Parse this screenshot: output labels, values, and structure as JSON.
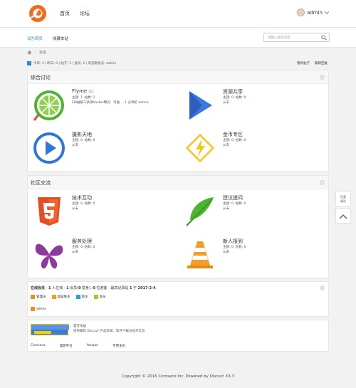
{
  "nav": {
    "home": "首页",
    "forum": "论坛",
    "username": "admin"
  },
  "subnav": {
    "set_home": "设为首页",
    "bookmark": "收藏本站",
    "search_placeholder": "请输入搜索内容"
  },
  "breadcrumb": {
    "current": "论坛"
  },
  "stats": {
    "text": "今日: 1 | 昨日: 0 | 帖子: 1 | 会员: 1 | 欢迎新会员: admin",
    "my_posts": "我的帖子",
    "latest_replies": "最新回复"
  },
  "sections": [
    {
      "title": "综合讨论",
      "forums": [
        {
          "name": "Flyme",
          "today": "(1)",
          "meta1": "主题: 1, 帖数: 1",
          "meta2": "FBI破解工具源hacker曝光：可破 ... 1 分钟前 admin"
        },
        {
          "name": "资源共享",
          "meta1": "主题: 0, 帖数: 0",
          "meta2": "从未"
        },
        {
          "name": "摄影天地",
          "meta1": "主题: 0, 帖数: 0",
          "meta2": "从未"
        },
        {
          "name": "金币专区",
          "meta1": "主题: 0, 帖数: 0",
          "meta2": "从未"
        }
      ]
    },
    {
      "title": "社区交流",
      "forums": [
        {
          "name": "技术互动",
          "meta1": "主题: 0, 帖数: 0",
          "meta2": "从未"
        },
        {
          "name": "建议提问",
          "meta1": "主题: 0, 帖数: 0",
          "meta2": "从未"
        },
        {
          "name": "服务处理",
          "meta1": "主题: 0, 帖数: 0",
          "meta2": "从未"
        },
        {
          "name": "新人报到",
          "meta1": "主题: 0, 帖数: 0",
          "meta2": "从未"
        }
      ]
    }
  ],
  "online": {
    "label": "在线会员",
    "sep": " - ",
    "n1": "1",
    "t1": " 人在线 - ",
    "n2": "1",
    "t2": " 会员(",
    "n3": "0",
    "t3": " 隐身), ",
    "n4": "0",
    "t4": " 位游客 - 最高记录是 ",
    "n5": "1",
    "t5": " 于 ",
    "date": "2017-2-4",
    "t6": ".",
    "legend": [
      {
        "label": "管理员",
        "color": "#f08a24"
      },
      {
        "label": "超级版主",
        "color": "#f0a020"
      },
      {
        "label": "版主",
        "color": "#2aa3d8"
      },
      {
        "label": "会员",
        "color": "#a0c830"
      }
    ],
    "user": "admin"
  },
  "partner": {
    "title": "官方论坛",
    "desc": "提供最新 Discuz! 产品新闻、软件下载与技术交流",
    "links": [
      "Comsenz",
      "漫游平台",
      "Yeswan",
      "专用主机"
    ]
  },
  "side": {
    "quick_reply": "回复",
    "quick_reply2": "新话"
  },
  "footer": "Copyright © 2016 Comsenz Inc.  Powered by Discuz! X3.3",
  "colors": {
    "accent": "#2a8ad4",
    "logo": "#f26a1b"
  }
}
